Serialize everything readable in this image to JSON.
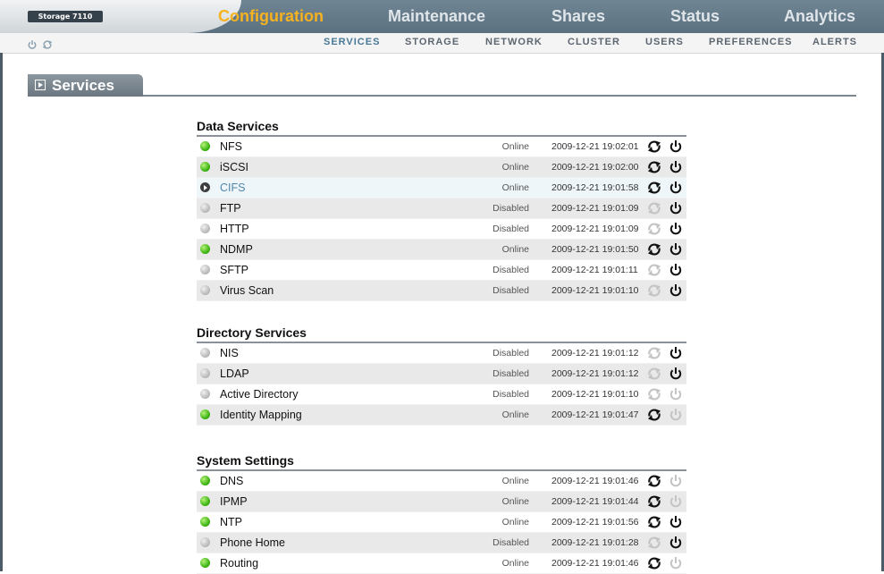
{
  "header": {
    "product": "Storage 7110",
    "main_nav": [
      "Configuration",
      "Maintenance",
      "Shares",
      "Status",
      "Analytics"
    ],
    "active_main": "Configuration",
    "sub_nav": [
      "SERVICES",
      "STORAGE",
      "NETWORK",
      "CLUSTER",
      "USERS",
      "PREFERENCES",
      "ALERTS"
    ],
    "active_sub": "SERVICES",
    "sub_icons": [
      "power-icon",
      "restart-icon"
    ]
  },
  "page": {
    "title": "Services"
  },
  "colors": {
    "active_nav": "#f6b21f",
    "online": "#37b10e",
    "disabled": "#b9b9b9",
    "selected_link": "#4f88a8"
  },
  "sections": [
    {
      "title": "Data Services",
      "rows": [
        {
          "name": "NFS",
          "status": "Online",
          "time": "2009-12-21 19:02:01",
          "dot": "green",
          "restart": true,
          "power": true
        },
        {
          "name": "iSCSI",
          "status": "Online",
          "time": "2009-12-21 19:02:00",
          "dot": "green",
          "restart": true,
          "power": true
        },
        {
          "name": "CIFS",
          "status": "Online",
          "time": "2009-12-21 19:01:58",
          "dot": "arrow",
          "restart": true,
          "power": true,
          "selected": true
        },
        {
          "name": "FTP",
          "status": "Disabled",
          "time": "2009-12-21 19:01:09",
          "dot": "gray",
          "restart": false,
          "power": true
        },
        {
          "name": "HTTP",
          "status": "Disabled",
          "time": "2009-12-21 19:01:09",
          "dot": "gray",
          "restart": false,
          "power": true
        },
        {
          "name": "NDMP",
          "status": "Online",
          "time": "2009-12-21 19:01:50",
          "dot": "green",
          "restart": true,
          "power": true
        },
        {
          "name": "SFTP",
          "status": "Disabled",
          "time": "2009-12-21 19:01:11",
          "dot": "gray",
          "restart": false,
          "power": true
        },
        {
          "name": "Virus Scan",
          "status": "Disabled",
          "time": "2009-12-21 19:01:10",
          "dot": "gray",
          "restart": false,
          "power": true
        }
      ]
    },
    {
      "title": "Directory Services",
      "rows": [
        {
          "name": "NIS",
          "status": "Disabled",
          "time": "2009-12-21 19:01:12",
          "dot": "gray",
          "restart": false,
          "power": true
        },
        {
          "name": "LDAP",
          "status": "Disabled",
          "time": "2009-12-21 19:01:12",
          "dot": "gray",
          "restart": false,
          "power": true
        },
        {
          "name": "Active Directory",
          "status": "Disabled",
          "time": "2009-12-21 19:01:10",
          "dot": "gray",
          "restart": false,
          "power": false
        },
        {
          "name": "Identity Mapping",
          "status": "Online",
          "time": "2009-12-21 19:01:47",
          "dot": "green",
          "restart": true,
          "power": false
        }
      ]
    },
    {
      "title": "System Settings",
      "rows": [
        {
          "name": "DNS",
          "status": "Online",
          "time": "2009-12-21 19:01:46",
          "dot": "green",
          "restart": true,
          "power": false
        },
        {
          "name": "IPMP",
          "status": "Online",
          "time": "2009-12-21 19:01:44",
          "dot": "green",
          "restart": true,
          "power": false
        },
        {
          "name": "NTP",
          "status": "Online",
          "time": "2009-12-21 19:01:56",
          "dot": "green",
          "restart": true,
          "power": true
        },
        {
          "name": "Phone Home",
          "status": "Disabled",
          "time": "2009-12-21 19:01:28",
          "dot": "gray",
          "restart": false,
          "power": true
        },
        {
          "name": "Routing",
          "status": "Online",
          "time": "2009-12-21 19:01:46",
          "dot": "green",
          "restart": true,
          "power": false
        }
      ]
    }
  ]
}
